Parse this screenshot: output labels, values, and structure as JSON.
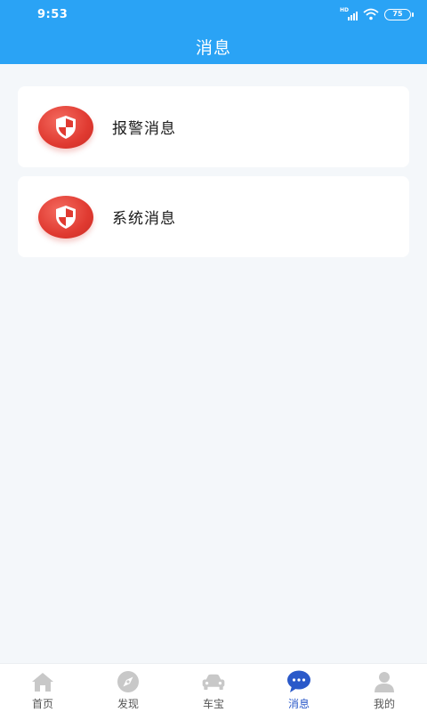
{
  "status_bar": {
    "time": "9:53",
    "signal_label": "HD",
    "battery": "75"
  },
  "header": {
    "title": "消息"
  },
  "messages": [
    {
      "label": "报警消息",
      "icon": "shield-icon"
    },
    {
      "label": "系统消息",
      "icon": "shield-icon"
    }
  ],
  "tabbar": {
    "tabs": [
      {
        "label": "首页",
        "icon": "home-icon"
      },
      {
        "label": "发现",
        "icon": "compass-icon"
      },
      {
        "label": "车宝",
        "icon": "car-icon"
      },
      {
        "label": "消息",
        "icon": "chat-icon",
        "active": true
      },
      {
        "label": "我的",
        "icon": "person-icon"
      }
    ]
  },
  "colors": {
    "primary": "#2aa3f5",
    "active_tab": "#2a59c9",
    "icon_red": "#e03a31",
    "inactive_icon": "#c8c8c8"
  }
}
